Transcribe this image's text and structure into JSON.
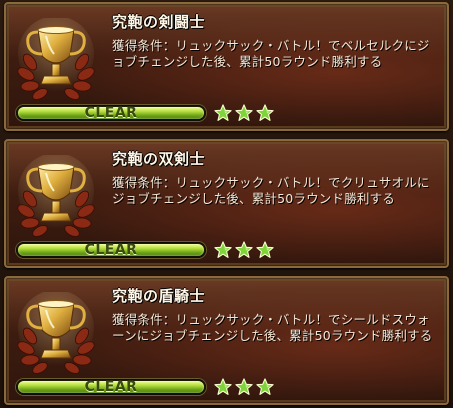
{
  "achievements": [
    {
      "title": "究鞄の剣闘士",
      "description": "獲得条件：リュックサック・バトル！でベルセルクにジョブチェンジした後、累計50ラウンド勝利する",
      "status": "CLEAR",
      "progress": 1.0,
      "stars": 3,
      "icon": "trophy-icon"
    },
    {
      "title": "究鞄の双剣士",
      "description": "獲得条件：リュックサック・バトル！でクリュサオルにジョブチェンジした後、累計50ラウンド勝利する",
      "status": "CLEAR",
      "progress": 1.0,
      "stars": 3,
      "icon": "trophy-icon"
    },
    {
      "title": "究鞄の盾騎士",
      "description": "獲得条件：リュックサック・バトル！でシールドスウォーンにジョブチェンジした後、累計50ラウンド勝利する",
      "status": "CLEAR",
      "progress": 1.0,
      "stars": 3,
      "icon": "trophy-icon"
    }
  ],
  "colors": {
    "star": "#7ed43a",
    "bar_fill": "#9ccc30",
    "trophy_gold": "#e0b040",
    "laurel": "#8a2a14"
  }
}
